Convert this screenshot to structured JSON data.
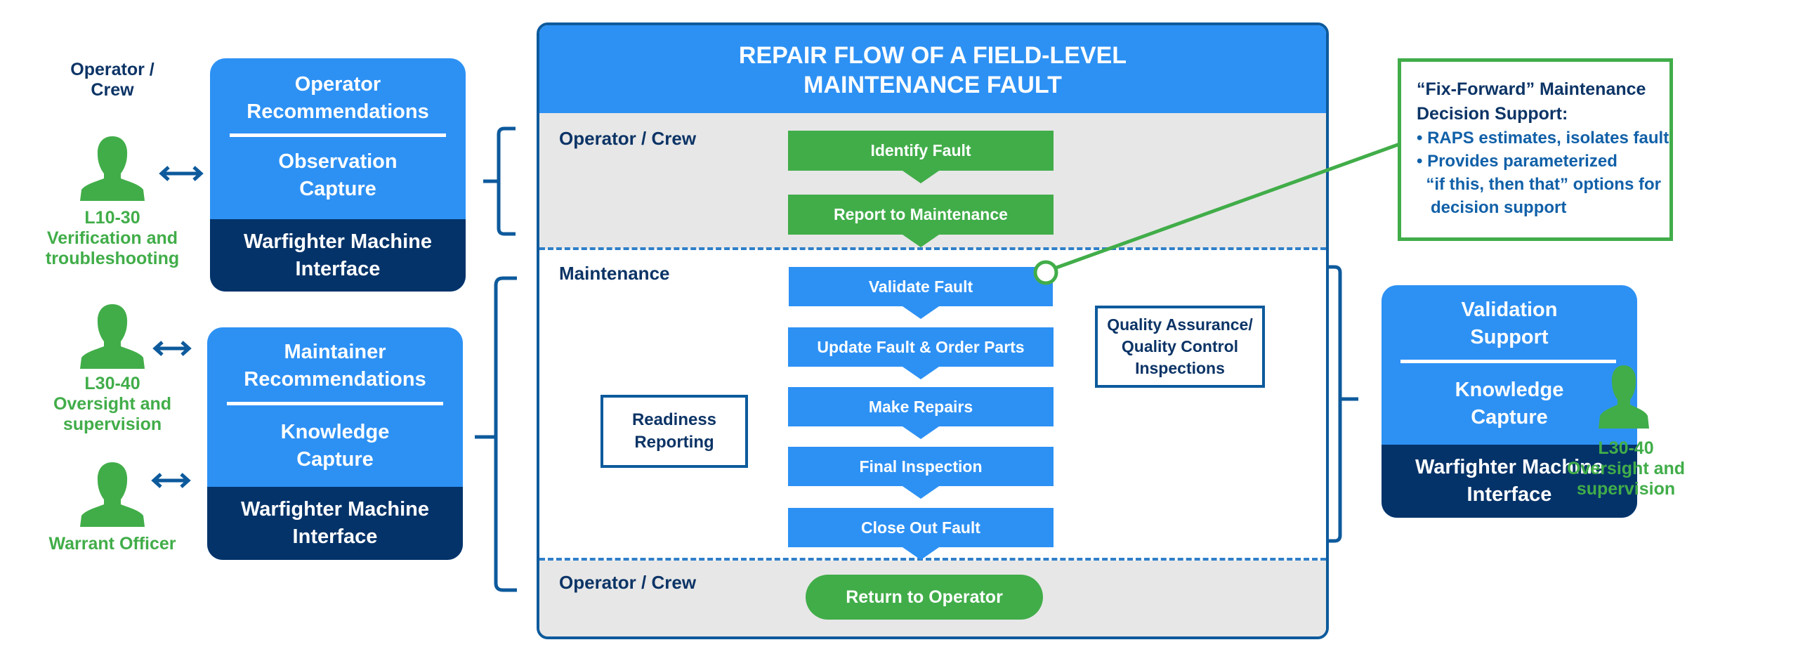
{
  "left": {
    "header_label": "Operator /\nCrew",
    "roles": [
      {
        "id": "l10-30",
        "label": "L10-30\nVerification and\ntroubleshooting"
      },
      {
        "id": "l30-40",
        "label": "L30-40\nOversight and\nsupervision"
      },
      {
        "id": "warrant-officer",
        "label": "Warrant Officer"
      }
    ],
    "panels": [
      {
        "top_a": "Operator\nRecommendations",
        "top_b": "Observation\nCapture",
        "bottom": "Warfighter Machine\nInterface"
      },
      {
        "top_a": "Maintainer\nRecommendations",
        "top_b": "Knowledge\nCapture",
        "bottom": "Warfighter Machine\nInterface"
      }
    ]
  },
  "main": {
    "title": "REPAIR FLOW OF A FIELD-LEVEL\nMAINTENANCE FAULT",
    "lanes": [
      {
        "label": "Operator / Crew"
      },
      {
        "label": "Maintenance"
      },
      {
        "label": "Operator / Crew"
      }
    ],
    "steps": [
      {
        "label": "Identify Fault",
        "color": "#41ad49"
      },
      {
        "label": "Report to Maintenance",
        "color": "#41ad49"
      },
      {
        "label": "Validate Fault",
        "color": "#2d91f4"
      },
      {
        "label": "Update Fault & Order Parts",
        "color": "#2d91f4"
      },
      {
        "label": "Make Repairs",
        "color": "#2d91f4"
      },
      {
        "label": "Final Inspection",
        "color": "#2d91f4"
      },
      {
        "label": "Close Out Fault",
        "color": "#2d91f4"
      }
    ],
    "readiness_reporting": "Readiness\nReporting",
    "qa_qc": "Quality Assurance/\nQuality Control\nInspections",
    "return_to_operator": "Return to Operator"
  },
  "callout": {
    "title": "“Fix-Forward” Maintenance\nDecision Support:",
    "bullets": [
      "• RAPS estimates, isolates fault",
      "• Provides parameterized\n  “if this, then that” options for\n   decision support"
    ]
  },
  "right": {
    "panel": {
      "top_a": "Validation\nSupport",
      "top_b": "Knowledge\nCapture",
      "bottom": "Warfighter Machine\nInterface"
    },
    "role": {
      "label": "L30-40\nOversight and\nsupervision"
    }
  },
  "colors": {
    "primary_blue": "#2d91f4",
    "navy": "#043369",
    "green": "#41ad49",
    "line_blue": "#0d5a9c",
    "lane_grey": "#e7e7e7"
  }
}
